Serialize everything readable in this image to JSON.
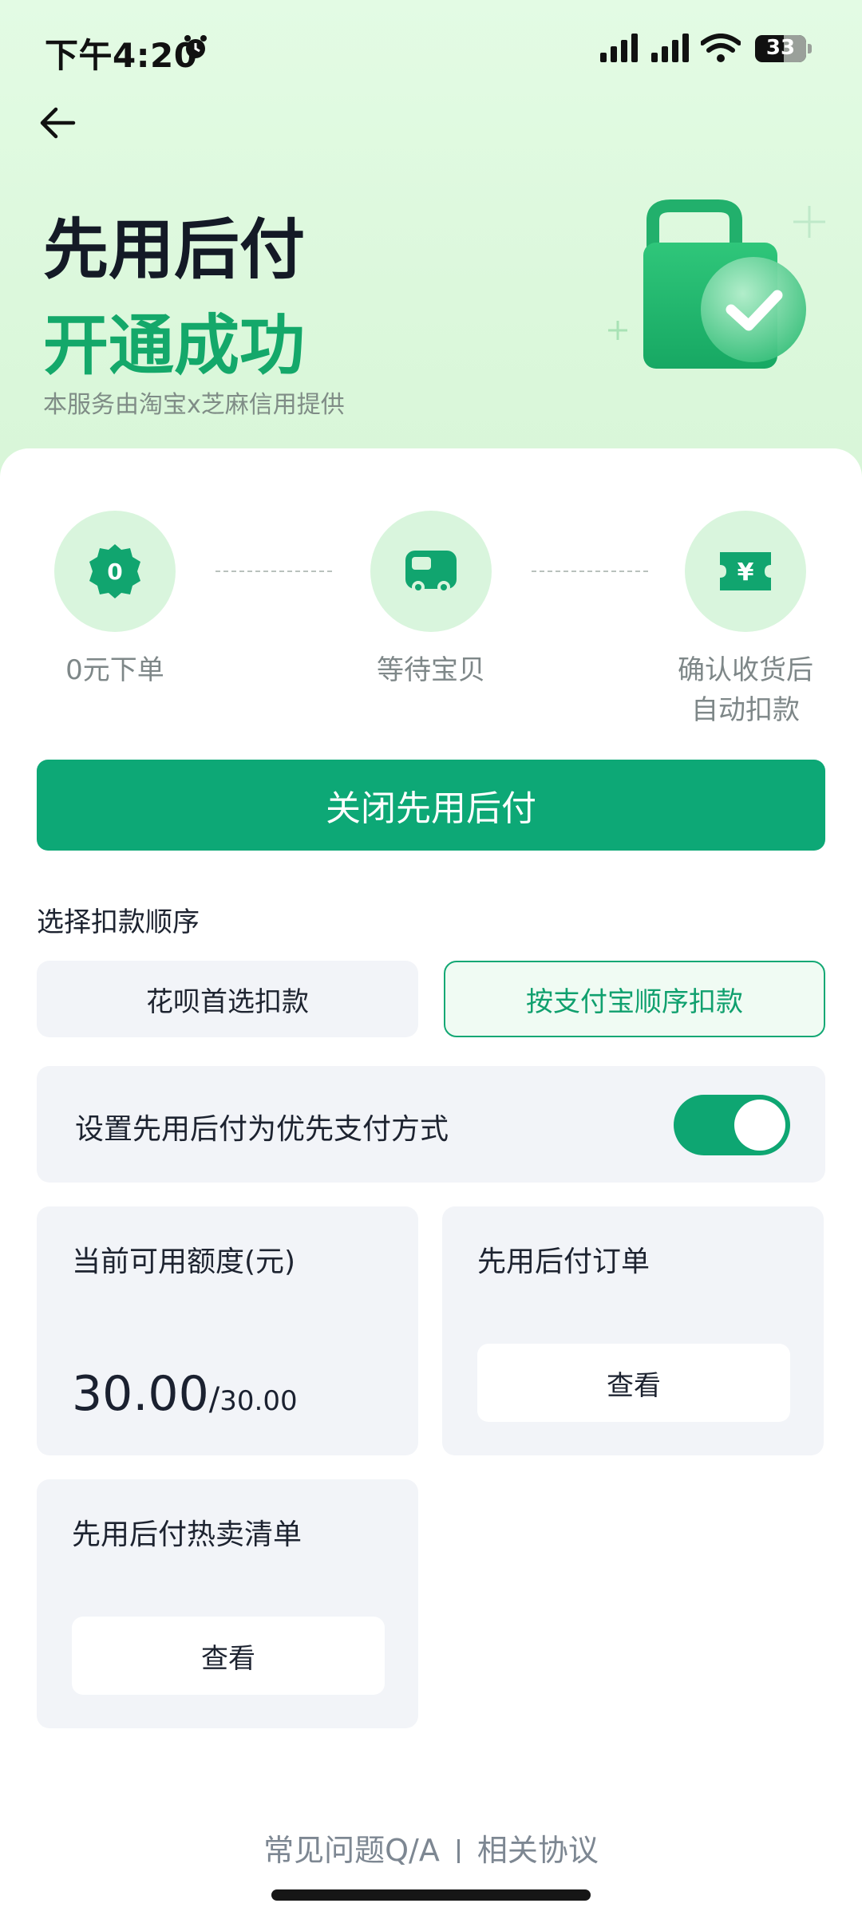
{
  "status_bar": {
    "time": "下午4:20",
    "battery": "33",
    "icons": [
      "alarm-icon",
      "signal-icon",
      "signal-icon",
      "wifi-icon",
      "battery-icon"
    ]
  },
  "header": {
    "back_icon": "back-arrow-icon",
    "title_line1": "先用后付",
    "title_line2": "开通成功",
    "subtitle": "本服务由淘宝x芝麻信用提供",
    "illustration": "shopping-bag-check-icon"
  },
  "steps": [
    {
      "label": "0元下单",
      "icon": "zero-badge-icon"
    },
    {
      "label": "等待宝贝",
      "icon": "truck-icon"
    },
    {
      "label_line1": "确认收货后",
      "label_line2": "自动扣款",
      "icon": "yuan-ticket-icon"
    }
  ],
  "primary_button": "关闭先用后付",
  "deduction": {
    "title": "选择扣款顺序",
    "options": [
      "花呗首选扣款",
      "按支付宝顺序扣款"
    ],
    "selected": "按支付宝顺序扣款"
  },
  "preference": {
    "label": "设置先用后付为优先支付方式",
    "enabled": true
  },
  "credit": {
    "label": "当前可用额度(元)",
    "available": "30.00",
    "slash": "/",
    "total": "30.00"
  },
  "orders": {
    "label": "先用后付订单",
    "button": "查看"
  },
  "hot_list": {
    "label": "先用后付热卖清单",
    "button": "查看"
  },
  "footer": {
    "faq": "常见问题Q/A",
    "agreement": "相关协议"
  },
  "colors": {
    "brand_green": "#0da876",
    "hero_bg": "#dcf8dc",
    "panel_bg": "#f2f4f8",
    "title_green": "#14a86a"
  }
}
